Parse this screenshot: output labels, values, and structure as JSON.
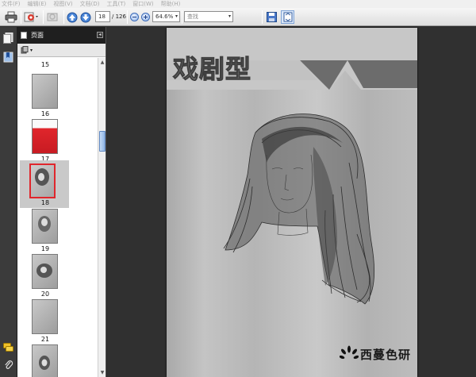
{
  "menu": [
    "文件(F)",
    "编辑(E)",
    "视图(V)",
    "文档(D)",
    "工具(T)",
    "窗口(W)",
    "帮助(H)"
  ],
  "toolbar": {
    "page_current": "18",
    "page_total": "/ 126",
    "zoom": "64.6%",
    "search_placeholder": "查找"
  },
  "panel": {
    "title": "页面",
    "collapse_glyph": "◂"
  },
  "thumbnails": [
    {
      "number": "15"
    },
    {
      "number": "16"
    },
    {
      "number": "17"
    },
    {
      "number": "18",
      "selected": true
    },
    {
      "number": "19"
    },
    {
      "number": "20"
    },
    {
      "number": "21"
    }
  ],
  "document": {
    "title": "戏剧型",
    "brand": "西蔓色研"
  },
  "colors": {
    "accent_red": "#e0262c",
    "selection": "#c9c9c9",
    "panel_dark": "#1f1f1f"
  },
  "icons": [
    "print-icon",
    "export-icon",
    "search-icon",
    "arrow-up-icon",
    "arrow-down-icon",
    "zoom-out-icon",
    "zoom-in-icon",
    "save-icon",
    "fit-page-icon",
    "pages-icon",
    "bookmark-icon",
    "comment-icon",
    "attachment-icon"
  ]
}
